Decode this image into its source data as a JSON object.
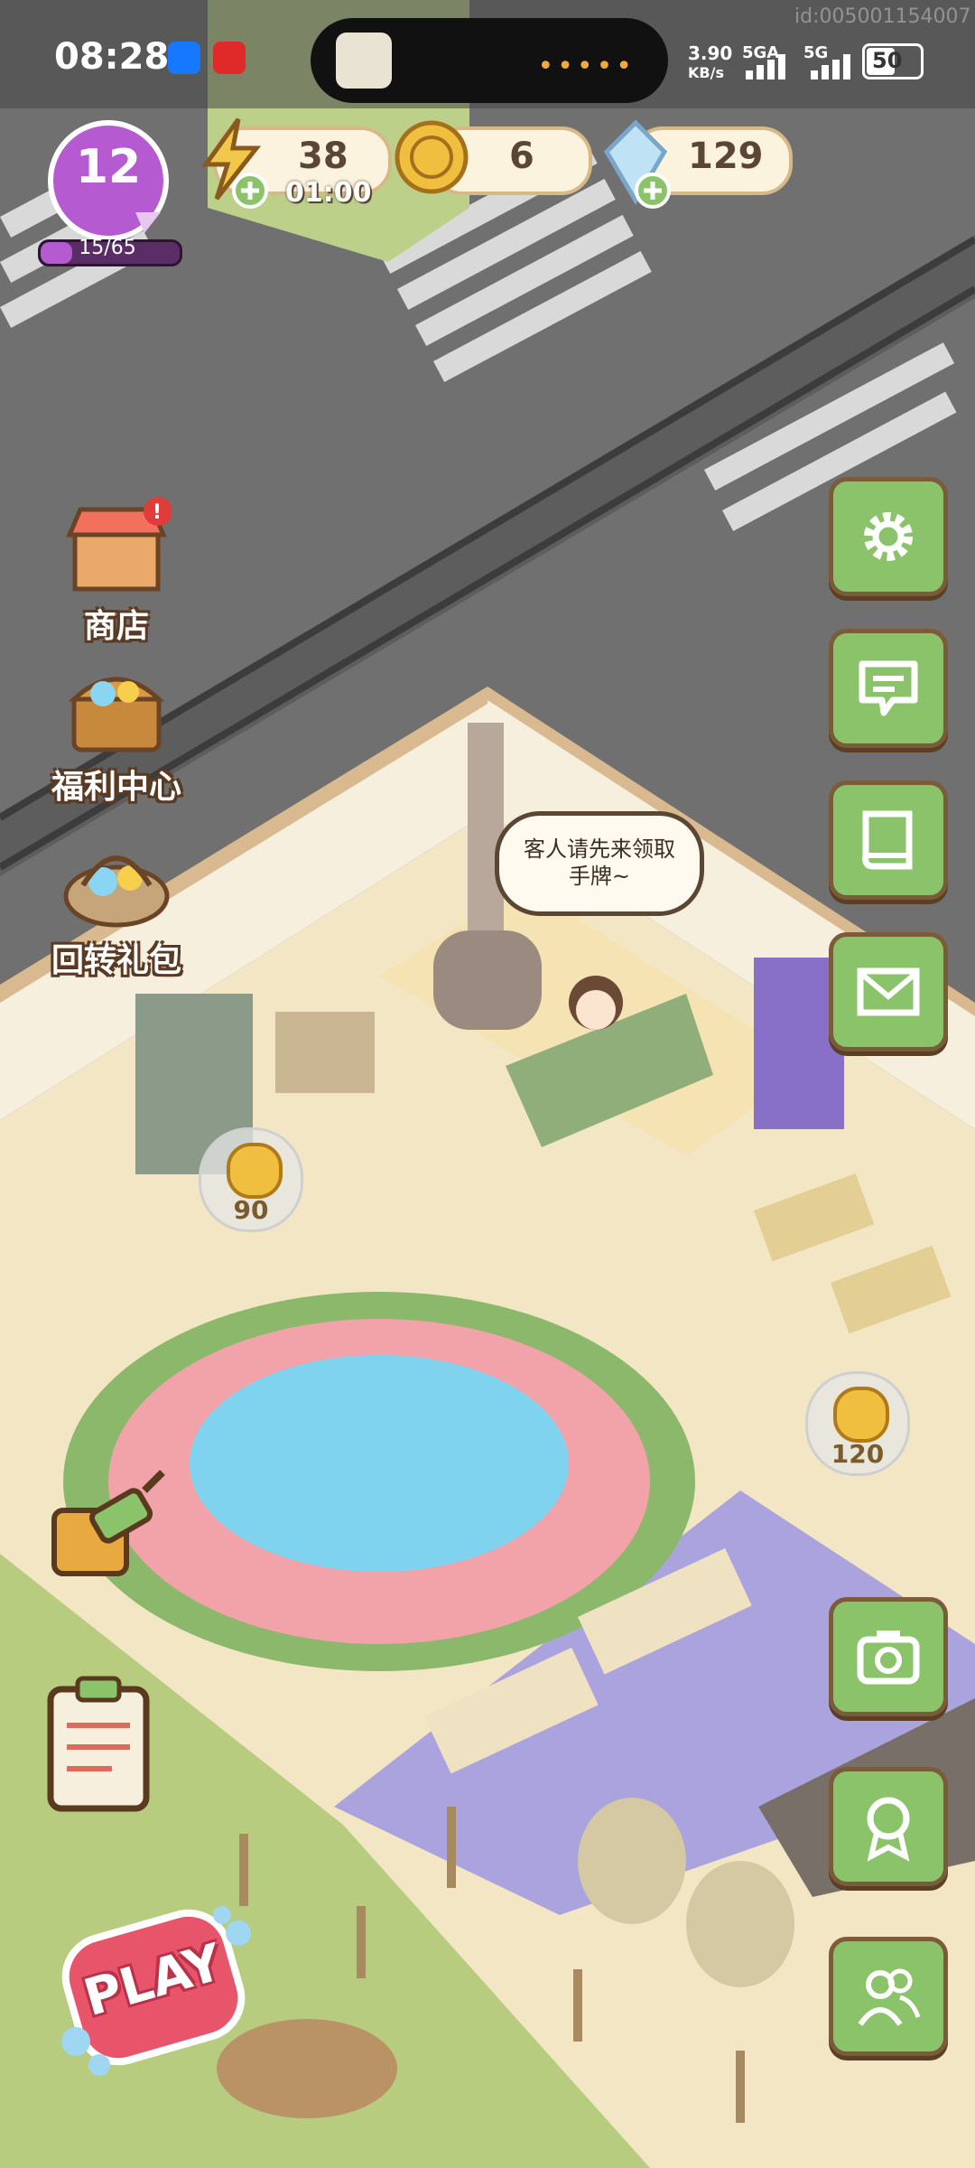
{
  "status_bar": {
    "time": "08:28",
    "network_speed": "3.90",
    "network_unit": "KB/s",
    "sig1": "5GA",
    "sig2": "5G",
    "battery": "50",
    "watermark": "id:005001154007"
  },
  "hud": {
    "level": "12",
    "xp": "15/65",
    "xp_progress": 0.23,
    "energy": "38",
    "energy_timer": "01:00",
    "coins": "6",
    "gems": "129"
  },
  "left_menu": {
    "shop": "商店",
    "welfare": "福利中心",
    "return_gift": "回转礼包"
  },
  "speech_bubble": {
    "line1": "客人请先来领取",
    "line2": "手牌~"
  },
  "coin_pins": {
    "pin1": "90",
    "pin2": "120"
  },
  "play": {
    "label": "PLAY"
  },
  "icons": {
    "settings": "gear-icon",
    "chat": "chat-icon",
    "book": "book-icon",
    "mail": "mail-icon",
    "camera": "camera-icon",
    "achievement": "badge-icon",
    "friends": "friends-icon",
    "decorate": "paint-roller-icon",
    "tasks": "clipboard-icon"
  },
  "colors": {
    "button_green": "#8bc36a",
    "button_border": "#7a5b3a",
    "level_purple": "#b55ad0",
    "coin_gold": "#f1bf3f",
    "play_pink": "#e8556a"
  }
}
